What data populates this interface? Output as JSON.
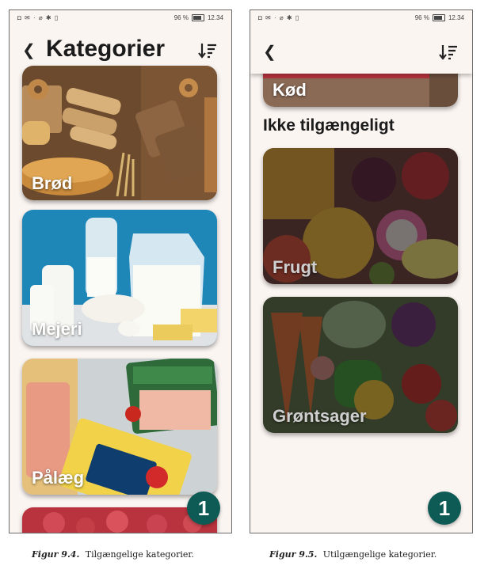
{
  "left_screen": {
    "status": {
      "left_icons": "◘ ✉ · ⌀ ✱ ▯",
      "battery": "96 %",
      "time": "12.34"
    },
    "title": "Kategorier",
    "categories": [
      {
        "label": "Brød"
      },
      {
        "label": "Mejeri"
      },
      {
        "label": "Pålæg"
      },
      {
        "label": ""
      }
    ],
    "fab_count": "1"
  },
  "right_screen": {
    "status": {
      "left_icons": "◘ ✉ · ⌀ ✱ ▯",
      "battery": "96 %",
      "time": "12.34"
    },
    "top_card_label": "Kød",
    "section_title": "Ikke tilgængeligt",
    "unavailable": [
      {
        "label": "Frugt"
      },
      {
        "label": "Grøntsager"
      }
    ],
    "fab_count": "1"
  },
  "captions": {
    "left": {
      "fig": "Figur 9.4.",
      "text": "Tilgængelige kategorier."
    },
    "right": {
      "fig": "Figur 9.5.",
      "text": "Utilgængelige kategorier."
    }
  },
  "colors": {
    "accent": "#0e5b55",
    "background": "#fbf5f2"
  },
  "icons": [
    "back-chevron-icon",
    "sort-icon"
  ]
}
